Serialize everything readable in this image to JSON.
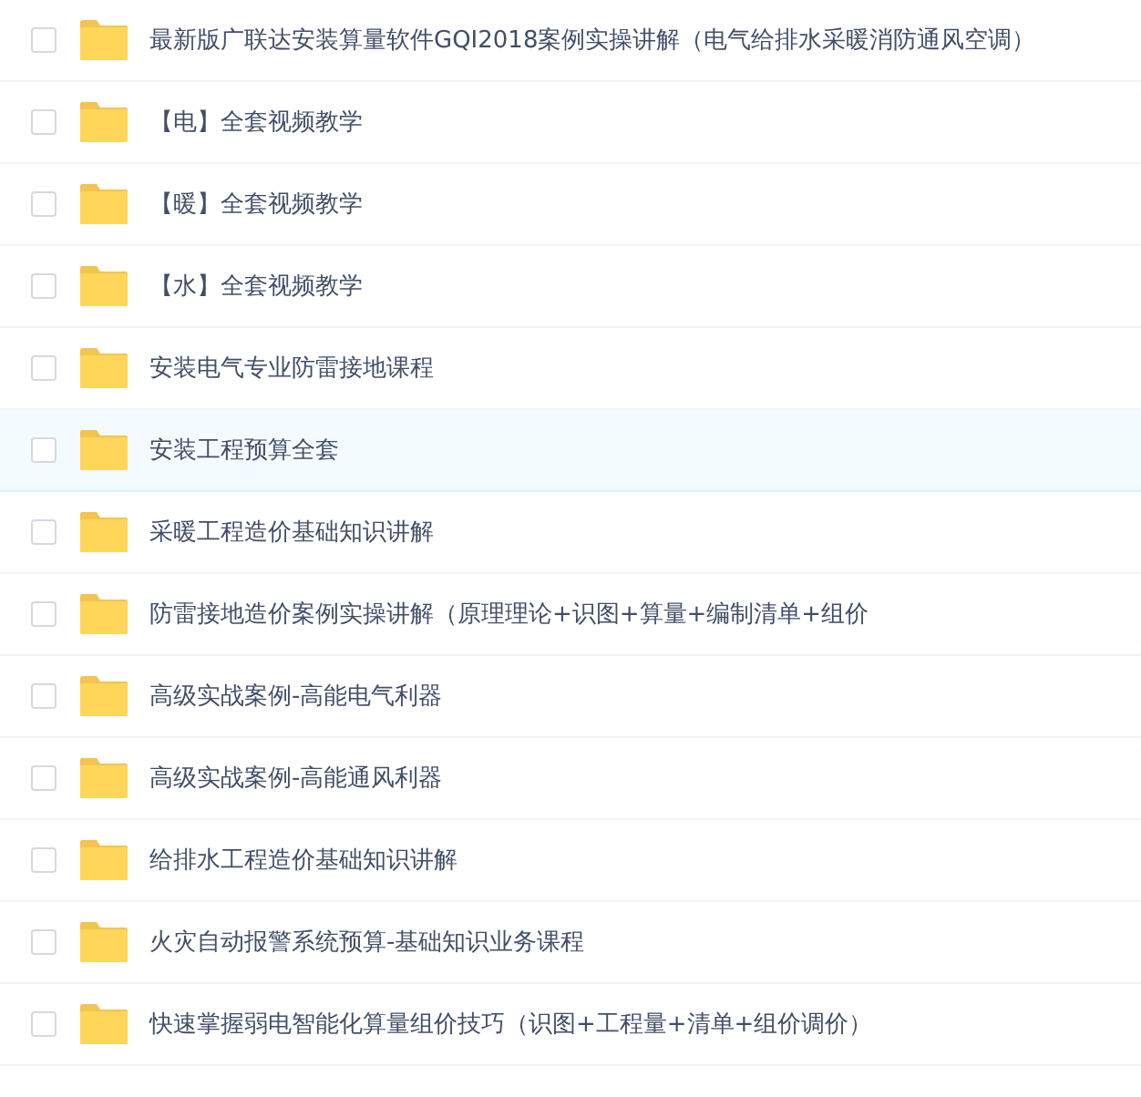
{
  "files": [
    {
      "name": "最新版广联达安装算量软件GQI2018案例实操讲解（电气给排水采暖消防通风空调）",
      "checked": false,
      "hovered": false
    },
    {
      "name": "【电】全套视频教学",
      "checked": false,
      "hovered": false
    },
    {
      "name": "【暖】全套视频教学",
      "checked": false,
      "hovered": false
    },
    {
      "name": "【水】全套视频教学",
      "checked": false,
      "hovered": false
    },
    {
      "name": "安装电气专业防雷接地课程",
      "checked": false,
      "hovered": false
    },
    {
      "name": "安装工程预算全套",
      "checked": false,
      "hovered": true
    },
    {
      "name": "采暖工程造价基础知识讲解",
      "checked": false,
      "hovered": false
    },
    {
      "name": "防雷接地造价案例实操讲解（原理理论+识图+算量+编制清单+组价",
      "checked": false,
      "hovered": false
    },
    {
      "name": "高级实战案例-高能电气利器",
      "checked": false,
      "hovered": false
    },
    {
      "name": "高级实战案例-高能通风利器",
      "checked": false,
      "hovered": false
    },
    {
      "name": "给排水工程造价基础知识讲解",
      "checked": false,
      "hovered": false
    },
    {
      "name": "火灾自动报警系统预算-基础知识业务课程",
      "checked": false,
      "hovered": false
    },
    {
      "name": "快速掌握弱电智能化算量组价技巧（识图+工程量+清单+组价调价）",
      "checked": false,
      "hovered": false
    }
  ]
}
